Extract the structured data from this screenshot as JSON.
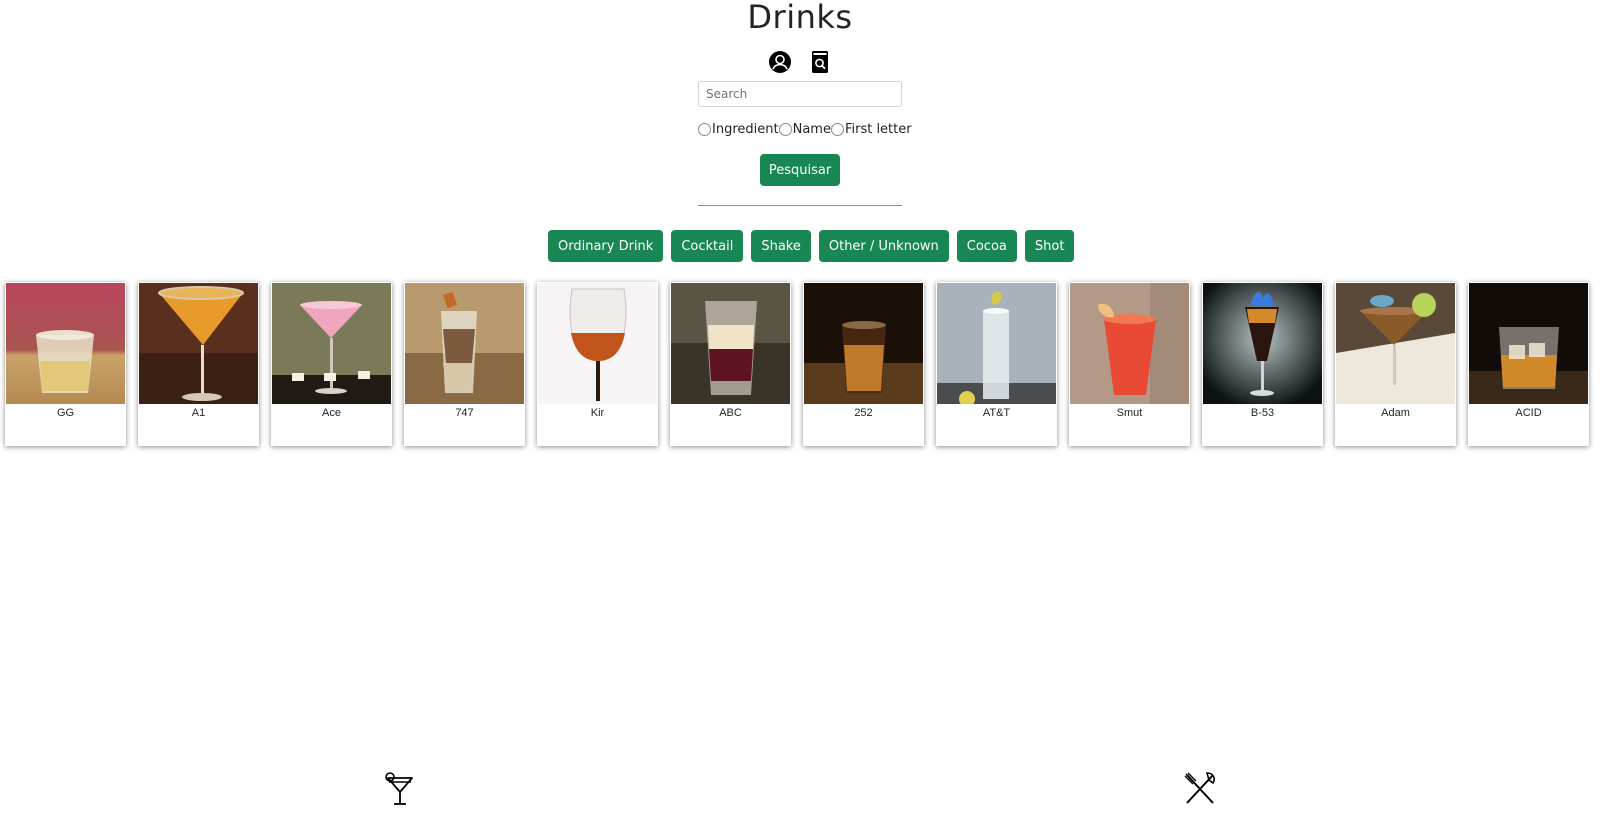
{
  "header": {
    "title": "Drinks"
  },
  "top_icons": {
    "profile": "profile-icon",
    "search": "search-book-icon"
  },
  "search": {
    "placeholder": "Search",
    "value": "",
    "options": [
      "Ingredient",
      "Name",
      "First letter"
    ],
    "submit_label": "Pesquisar"
  },
  "categories": [
    "Ordinary Drink",
    "Cocktail",
    "Shake",
    "Other / Unknown",
    "Cocoa",
    "Shot"
  ],
  "drinks": [
    "GG",
    "A1",
    "Ace",
    "747",
    "Kir",
    "ABC",
    "252",
    "AT&T",
    "Smut",
    "B-53",
    "Adam",
    "ACID"
  ],
  "bottom_nav": {
    "drinks": "cocktail-icon",
    "foods": "fork-knife-icon"
  },
  "colors": {
    "accent": "#198754",
    "text": "#212529",
    "border": "#ced4da"
  }
}
